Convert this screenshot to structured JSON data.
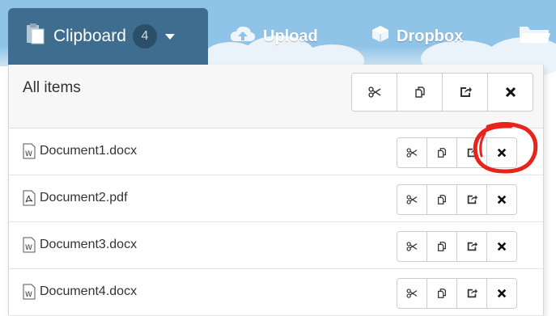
{
  "toolbar": {
    "clipboard_label": "Clipboard",
    "clipboard_count": "4",
    "upload_label": "Upload",
    "dropbox_label": "Dropbox"
  },
  "panel": {
    "title": "All items",
    "actions": [
      "cut",
      "copy",
      "paste",
      "delete"
    ]
  },
  "items": [
    {
      "name": "Document1.docx",
      "type": "word"
    },
    {
      "name": "Document2.pdf",
      "type": "pdf"
    },
    {
      "name": "Document3.docx",
      "type": "word"
    },
    {
      "name": "Document4.docx",
      "type": "word"
    }
  ],
  "annotation": {
    "target": "Document1.docx delete button",
    "color": "#e8221c"
  },
  "colors": {
    "accent": "#3e6d8f",
    "toolbar_bg": "#8fc4e8",
    "badge": "#2c4f69"
  }
}
